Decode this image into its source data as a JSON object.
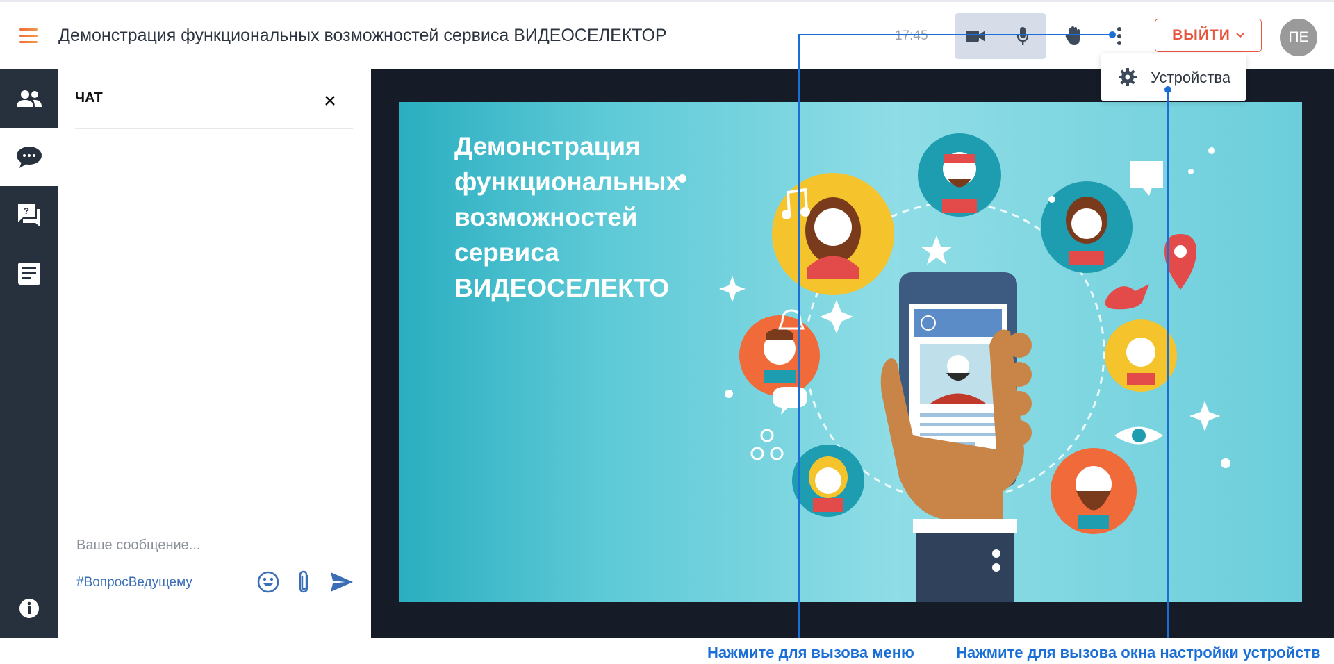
{
  "header": {
    "menu_icon": "hamburger-icon",
    "title": "Демонстрация функциональных возможностей сервиса ВИДЕОСЕЛЕКТОР",
    "clock": "17:45",
    "camera_icon": "video-camera-icon",
    "mic_icon": "microphone-icon",
    "hand_icon": "raise-hand-icon",
    "more_icon": "more-vertical-icon",
    "logout_label": "ВЫЙТИ",
    "avatar_initials": "ПЕ"
  },
  "sidebar": {
    "items": [
      {
        "icon": "participants-icon"
      },
      {
        "icon": "chat-icon",
        "active": true
      },
      {
        "icon": "questions-icon"
      },
      {
        "icon": "notes-icon"
      }
    ],
    "info_icon": "info-icon"
  },
  "chat": {
    "title": "ЧАТ",
    "input_placeholder": "Ваше сообщение...",
    "hashtag": "#ВопросВедущему"
  },
  "slide": {
    "title": "Демонстрация функциональных возможностей сервиса ВИДЕОСЕЛЕКТО"
  },
  "menu_popup": {
    "items": [
      {
        "label": "Устройства",
        "icon": "gear-icon"
      }
    ]
  },
  "annotations": {
    "menu_hint": "Нажмите для вызова меню",
    "devices_hint": "Нажмите для вызова окна настройки устройств"
  },
  "colors": {
    "accent_red": "#e8553e",
    "callout_blue": "#1a6fd6",
    "sidebar_bg": "#27303d"
  }
}
